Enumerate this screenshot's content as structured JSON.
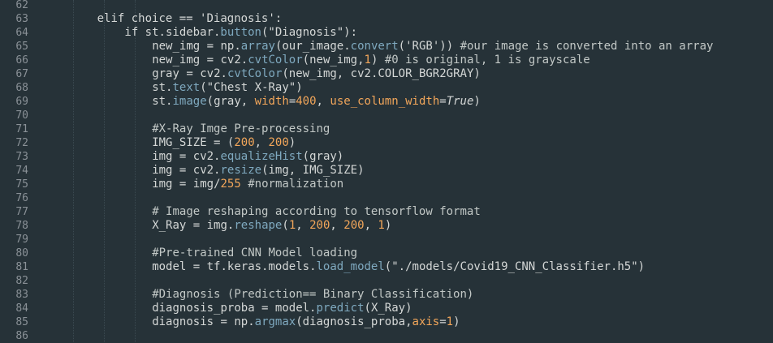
{
  "editor": {
    "lines": [
      {
        "n": "62",
        "indent": 0,
        "tokens": []
      },
      {
        "n": "63",
        "indent": 8,
        "tokens": [
          {
            "t": "elif choice ",
            "c": "kw"
          },
          {
            "t": "==",
            "c": "op"
          },
          {
            "t": " ",
            "c": "plain"
          },
          {
            "t": "'Diagnosis'",
            "c": "str"
          },
          {
            "t": ":",
            "c": "plain"
          }
        ]
      },
      {
        "n": "64",
        "indent": 12,
        "tokens": [
          {
            "t": "if st.sidebar.",
            "c": "plain"
          },
          {
            "t": "button",
            "c": "fn"
          },
          {
            "t": "(",
            "c": "plain"
          },
          {
            "t": "\"Diagnosis\"",
            "c": "str"
          },
          {
            "t": "):",
            "c": "plain"
          }
        ]
      },
      {
        "n": "65",
        "indent": 16,
        "tokens": [
          {
            "t": "new_img ",
            "c": "plain"
          },
          {
            "t": "=",
            "c": "op"
          },
          {
            "t": " np.",
            "c": "plain"
          },
          {
            "t": "array",
            "c": "fn"
          },
          {
            "t": "(our_image.",
            "c": "plain"
          },
          {
            "t": "convert",
            "c": "fn"
          },
          {
            "t": "(",
            "c": "plain"
          },
          {
            "t": "'RGB'",
            "c": "str"
          },
          {
            "t": ")) ",
            "c": "plain"
          },
          {
            "t": "#our image is converted into an array",
            "c": "comment"
          }
        ]
      },
      {
        "n": "66",
        "indent": 16,
        "tokens": [
          {
            "t": "new_img ",
            "c": "plain"
          },
          {
            "t": "=",
            "c": "op"
          },
          {
            "t": " cv2.",
            "c": "plain"
          },
          {
            "t": "cvtColor",
            "c": "fn"
          },
          {
            "t": "(new_img,",
            "c": "plain"
          },
          {
            "t": "1",
            "c": "num"
          },
          {
            "t": ") ",
            "c": "plain"
          },
          {
            "t": "#0 is original, 1 is grayscale",
            "c": "comment"
          }
        ]
      },
      {
        "n": "67",
        "indent": 16,
        "tokens": [
          {
            "t": "gray ",
            "c": "plain"
          },
          {
            "t": "=",
            "c": "op"
          },
          {
            "t": " cv2.",
            "c": "plain"
          },
          {
            "t": "cvtColor",
            "c": "fn"
          },
          {
            "t": "(new_img, cv2.COLOR_BGR2GRAY)",
            "c": "plain"
          }
        ]
      },
      {
        "n": "68",
        "indent": 16,
        "tokens": [
          {
            "t": "st.",
            "c": "plain"
          },
          {
            "t": "text",
            "c": "fn"
          },
          {
            "t": "(",
            "c": "plain"
          },
          {
            "t": "\"Chest X-Ray\"",
            "c": "str"
          },
          {
            "t": ")",
            "c": "plain"
          }
        ]
      },
      {
        "n": "69",
        "indent": 16,
        "tokens": [
          {
            "t": "st.",
            "c": "plain"
          },
          {
            "t": "image",
            "c": "fn"
          },
          {
            "t": "(gray, ",
            "c": "plain"
          },
          {
            "t": "width",
            "c": "param"
          },
          {
            "t": "=",
            "c": "op"
          },
          {
            "t": "400",
            "c": "num"
          },
          {
            "t": ", ",
            "c": "plain"
          },
          {
            "t": "use_column_width",
            "c": "param"
          },
          {
            "t": "=",
            "c": "op"
          },
          {
            "t": "True",
            "c": "const"
          },
          {
            "t": ")",
            "c": "plain"
          }
        ]
      },
      {
        "n": "70",
        "indent": 0,
        "tokens": []
      },
      {
        "n": "71",
        "indent": 16,
        "tokens": [
          {
            "t": "#X-Ray Imge Pre-processing",
            "c": "comment"
          }
        ]
      },
      {
        "n": "72",
        "indent": 16,
        "tokens": [
          {
            "t": "IMG_SIZE ",
            "c": "plain"
          },
          {
            "t": "=",
            "c": "op"
          },
          {
            "t": " (",
            "c": "plain"
          },
          {
            "t": "200",
            "c": "num"
          },
          {
            "t": ", ",
            "c": "plain"
          },
          {
            "t": "200",
            "c": "num"
          },
          {
            "t": ")",
            "c": "plain"
          }
        ]
      },
      {
        "n": "73",
        "indent": 16,
        "tokens": [
          {
            "t": "img ",
            "c": "plain"
          },
          {
            "t": "=",
            "c": "op"
          },
          {
            "t": " cv2.",
            "c": "plain"
          },
          {
            "t": "equalizeHist",
            "c": "fn"
          },
          {
            "t": "(gray)",
            "c": "plain"
          }
        ]
      },
      {
        "n": "74",
        "indent": 16,
        "tokens": [
          {
            "t": "img ",
            "c": "plain"
          },
          {
            "t": "=",
            "c": "op"
          },
          {
            "t": " cv2.",
            "c": "plain"
          },
          {
            "t": "resize",
            "c": "fn"
          },
          {
            "t": "(img, IMG_SIZE)",
            "c": "plain"
          }
        ]
      },
      {
        "n": "75",
        "indent": 16,
        "tokens": [
          {
            "t": "img ",
            "c": "plain"
          },
          {
            "t": "=",
            "c": "op"
          },
          {
            "t": " img",
            "c": "plain"
          },
          {
            "t": "/",
            "c": "op"
          },
          {
            "t": "255",
            "c": "num"
          },
          {
            "t": " ",
            "c": "plain"
          },
          {
            "t": "#normalization",
            "c": "comment"
          }
        ]
      },
      {
        "n": "76",
        "indent": 0,
        "tokens": []
      },
      {
        "n": "77",
        "indent": 16,
        "tokens": [
          {
            "t": "# Image reshaping according to tensorflow format",
            "c": "comment"
          }
        ]
      },
      {
        "n": "78",
        "indent": 16,
        "tokens": [
          {
            "t": "X_Ray ",
            "c": "plain"
          },
          {
            "t": "=",
            "c": "op"
          },
          {
            "t": " img.",
            "c": "plain"
          },
          {
            "t": "reshape",
            "c": "fn"
          },
          {
            "t": "(",
            "c": "plain"
          },
          {
            "t": "1",
            "c": "num"
          },
          {
            "t": ", ",
            "c": "plain"
          },
          {
            "t": "200",
            "c": "num"
          },
          {
            "t": ", ",
            "c": "plain"
          },
          {
            "t": "200",
            "c": "num"
          },
          {
            "t": ", ",
            "c": "plain"
          },
          {
            "t": "1",
            "c": "num"
          },
          {
            "t": ")",
            "c": "plain"
          }
        ]
      },
      {
        "n": "79",
        "indent": 0,
        "tokens": []
      },
      {
        "n": "80",
        "indent": 16,
        "tokens": [
          {
            "t": "#Pre-trained CNN Model loading",
            "c": "comment"
          }
        ]
      },
      {
        "n": "81",
        "indent": 16,
        "tokens": [
          {
            "t": "model ",
            "c": "plain"
          },
          {
            "t": "=",
            "c": "op"
          },
          {
            "t": " tf.keras.models.",
            "c": "plain"
          },
          {
            "t": "load_model",
            "c": "fn"
          },
          {
            "t": "(",
            "c": "plain"
          },
          {
            "t": "\"./models/Covid19_CNN_Classifier.h5\"",
            "c": "str"
          },
          {
            "t": ")",
            "c": "plain"
          }
        ]
      },
      {
        "n": "82",
        "indent": 0,
        "tokens": []
      },
      {
        "n": "83",
        "indent": 16,
        "tokens": [
          {
            "t": "#Diagnosis (Prediction== Binary Classification)",
            "c": "comment"
          }
        ]
      },
      {
        "n": "84",
        "indent": 16,
        "tokens": [
          {
            "t": "diagnosis_proba ",
            "c": "plain"
          },
          {
            "t": "=",
            "c": "op"
          },
          {
            "t": " model.",
            "c": "plain"
          },
          {
            "t": "predict",
            "c": "fn"
          },
          {
            "t": "(X_Ray)",
            "c": "plain"
          }
        ]
      },
      {
        "n": "85",
        "indent": 16,
        "tokens": [
          {
            "t": "diagnosis ",
            "c": "plain"
          },
          {
            "t": "=",
            "c": "op"
          },
          {
            "t": " np.",
            "c": "plain"
          },
          {
            "t": "argmax",
            "c": "fn"
          },
          {
            "t": "(diagnosis_proba,",
            "c": "plain"
          },
          {
            "t": "axis",
            "c": "param"
          },
          {
            "t": "=",
            "c": "op"
          },
          {
            "t": "1",
            "c": "num"
          },
          {
            "t": ")",
            "c": "plain"
          }
        ]
      },
      {
        "n": "86",
        "indent": 0,
        "tokens": []
      }
    ]
  }
}
